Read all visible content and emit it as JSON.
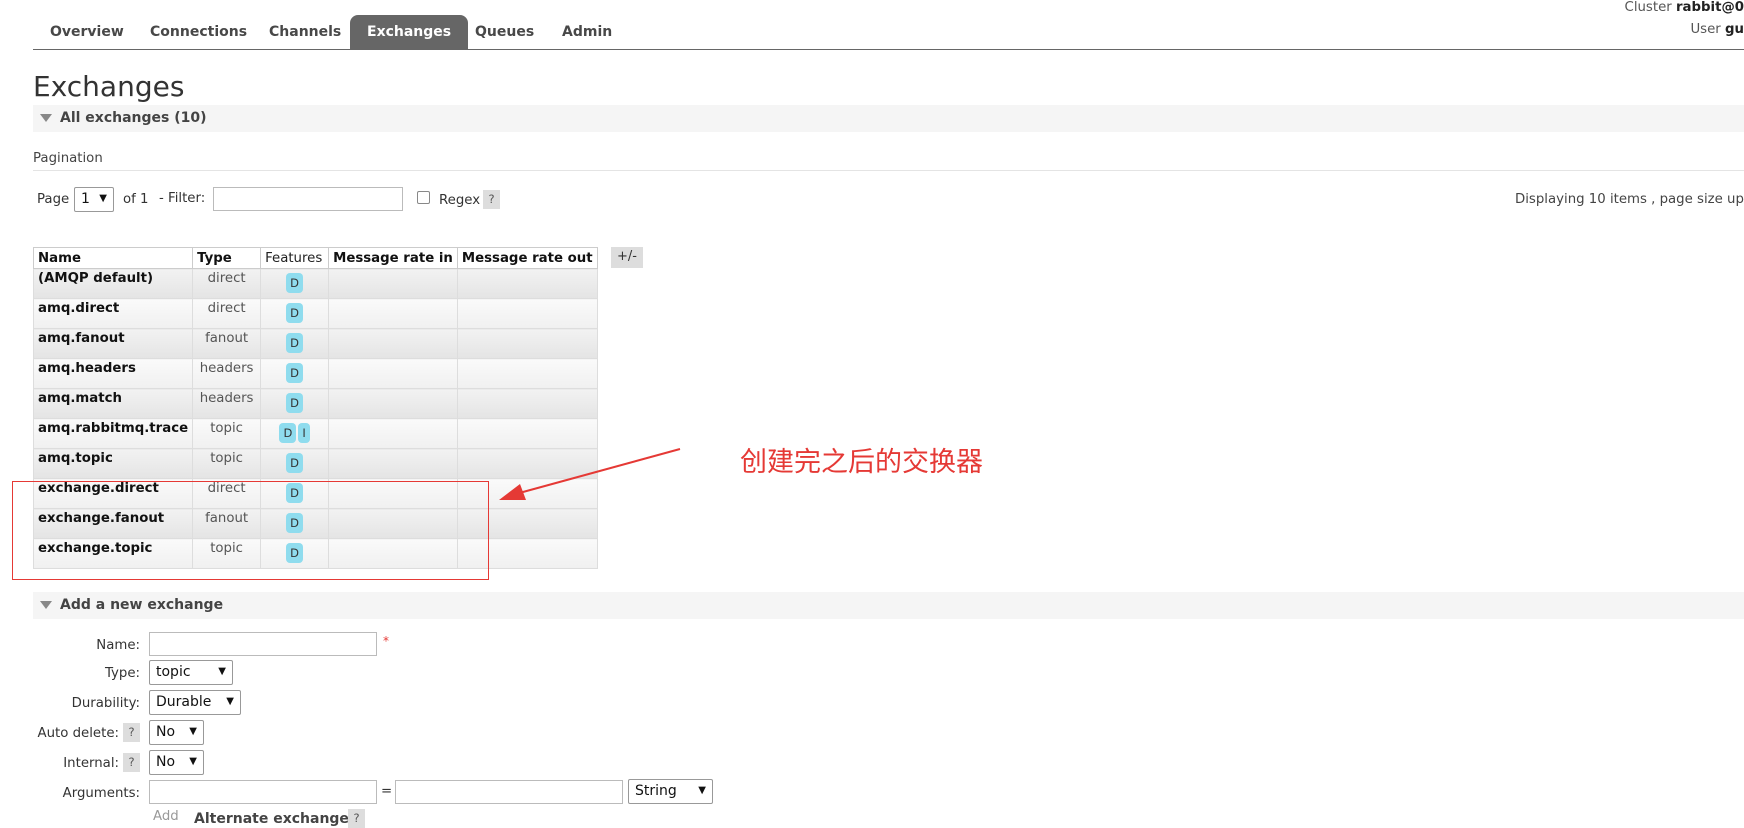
{
  "nav": {
    "tabs": [
      {
        "label": "Overview"
      },
      {
        "label": "Connections"
      },
      {
        "label": "Channels"
      },
      {
        "label": "Exchanges"
      },
      {
        "label": "Queues"
      },
      {
        "label": "Admin"
      }
    ],
    "active_tab": "Exchanges",
    "cluster_label": "Cluster",
    "cluster_value": "rabbit@0",
    "user_label": "User",
    "user_value": "gu"
  },
  "page_title": "Exchanges",
  "all_exchanges": {
    "label": "All exchanges (10)"
  },
  "pagination": {
    "section_label": "Pagination",
    "page_label": "Page",
    "page_value": "1",
    "of_label": "of 1",
    "filter_label": "- Filter:",
    "filter_value": "",
    "regex_label": "Regex",
    "help_label": "?",
    "display_info": "Displaying 10 items , page size up"
  },
  "table": {
    "headers": {
      "name": "Name",
      "type": "Type",
      "features": "Features",
      "rate_in": "Message rate in",
      "rate_out": "Message rate out"
    },
    "toggle_label": "+/-",
    "rows": [
      {
        "name": "(AMQP default)",
        "type": "direct",
        "features": [
          "D"
        ]
      },
      {
        "name": "amq.direct",
        "type": "direct",
        "features": [
          "D"
        ]
      },
      {
        "name": "amq.fanout",
        "type": "fanout",
        "features": [
          "D"
        ]
      },
      {
        "name": "amq.headers",
        "type": "headers",
        "features": [
          "D"
        ]
      },
      {
        "name": "amq.match",
        "type": "headers",
        "features": [
          "D"
        ]
      },
      {
        "name": "amq.rabbitmq.trace",
        "type": "topic",
        "features": [
          "D",
          "I"
        ]
      },
      {
        "name": "amq.topic",
        "type": "topic",
        "features": [
          "D"
        ]
      },
      {
        "name": "exchange.direct",
        "type": "direct",
        "features": [
          "D"
        ]
      },
      {
        "name": "exchange.fanout",
        "type": "fanout",
        "features": [
          "D"
        ]
      },
      {
        "name": "exchange.topic",
        "type": "topic",
        "features": [
          "D"
        ]
      }
    ]
  },
  "annotation": {
    "text": "创建完之后的交换器",
    "color": "#e53935"
  },
  "add_exchange": {
    "label": "Add a new exchange",
    "name_label": "Name:",
    "name_value": "",
    "required_mark": "*",
    "type_label": "Type:",
    "type_value": "topic",
    "durability_label": "Durability:",
    "durability_value": "Durable",
    "auto_delete_label": "Auto delete:",
    "auto_delete_value": "No",
    "internal_label": "Internal:",
    "internal_value": "No",
    "arguments_label": "Arguments:",
    "arg_key_value": "",
    "equals": "=",
    "arg_val_value": "",
    "arg_type_value": "String",
    "add_label": "Add",
    "alternate_label": "Alternate exchange",
    "help_label": "?"
  },
  "colors": {
    "active_tab_bg": "#666666",
    "badge_bg": "#8fdcee",
    "annotation": "#e53935"
  }
}
